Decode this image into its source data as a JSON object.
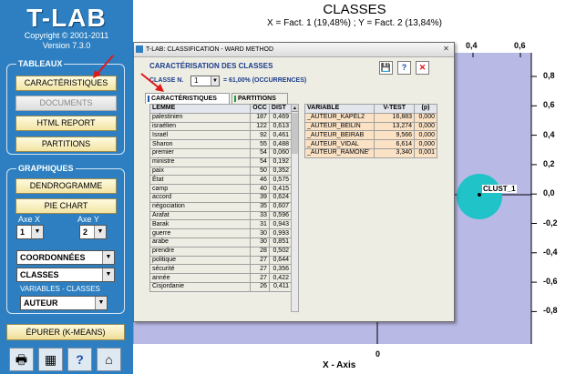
{
  "app": {
    "logo": "T-LAB",
    "copyright": "Copyright © 2001-2011",
    "version": "Version 7.3.0"
  },
  "sidebar": {
    "tableaux_title": "TABLEAUX",
    "btn_caracteristiques": "CARACTÉRISTIQUES",
    "btn_documents": "DOCUMENTS",
    "btn_html_report": "HTML REPORT",
    "btn_partitions": "PARTITIONS",
    "graphiques_title": "GRAPHIQUES",
    "btn_dendrogramme": "DENDROGRAMME",
    "btn_pie_chart": "PIE CHART",
    "axe_x_label": "Axe X",
    "axe_y_label": "Axe Y",
    "axe_x_value": "1",
    "axe_y_value": "2",
    "coordonnees": "COORDONNÉES",
    "classes": "CLASSES",
    "variables_title": "VARIABLES - CLASSES",
    "variables_value": "AUTEUR",
    "btn_epurer": "ÉPURER (K-MEANS)",
    "bottom_icons": [
      "print-icon",
      "table-chart-icon",
      "help-icon",
      "home-icon"
    ]
  },
  "chart": {
    "title": "CLASSES",
    "subtitle": "X = Fact. 1 (19,48%) ; Y = Fact. 2 (13,84%)",
    "x_ticks_top": [
      "0,4",
      "0,6"
    ],
    "y_ticks": [
      "0,8",
      "0,6",
      "0,4",
      "0,2",
      "0,0",
      "-0,2",
      "-0,4",
      "-0,6",
      "-0,8"
    ],
    "x_axis_zero": "0",
    "xlabel": "X - Axis",
    "cluster_label": "CLUST_1",
    "cluster_color": "#1fc3c8",
    "plot_color": "#b9b9e6"
  },
  "dialog": {
    "title": "T-LAB: CLASSIFICATION - WARD METHOD",
    "close_label": "✕",
    "header": "CARACTÉRISATION DES CLASSES",
    "classe_label": "CLASSE N.",
    "classe_value": "1",
    "pct_text": "= 61,00% (OCCURRENCES)",
    "tabs": [
      "CARACTÉRISTIQUES",
      "PARTITIONS"
    ],
    "lemma_columns": [
      "LEMME",
      "OCC",
      "DIST"
    ],
    "lemmas": [
      [
        "palestinien",
        "187",
        "0,469"
      ],
      [
        "israélien",
        "122",
        "0,613"
      ],
      [
        "Israël",
        "92",
        "0,461"
      ],
      [
        "Sharon",
        "55",
        "0,488"
      ],
      [
        "premier",
        "54",
        "0,060"
      ],
      [
        "ministre",
        "54",
        "0,192"
      ],
      [
        "paix",
        "50",
        "0,352"
      ],
      [
        "État",
        "46",
        "0,575"
      ],
      [
        "camp",
        "40",
        "0,415"
      ],
      [
        "accord",
        "39",
        "0,624"
      ],
      [
        "négociation",
        "35",
        "0,607"
      ],
      [
        "Arafat",
        "33",
        "0,596"
      ],
      [
        "Barak",
        "31",
        "0,943"
      ],
      [
        "guerre",
        "30",
        "0,993"
      ],
      [
        "arabe",
        "30",
        "0,851"
      ],
      [
        "prendre",
        "28",
        "0,502"
      ],
      [
        "politique",
        "27",
        "0,644"
      ],
      [
        "sécurité",
        "27",
        "0,356"
      ],
      [
        "année",
        "27",
        "0,422"
      ],
      [
        "Cisjordanie",
        "26",
        "0,411"
      ]
    ],
    "variable_columns": [
      "VARIABLE",
      "V-TEST",
      "(p)"
    ],
    "variables": [
      [
        "_AUTEUR_KAPEL2",
        "16,883",
        "0,000"
      ],
      [
        "_AUTEUR_BEILIN",
        "13,274",
        "0,000"
      ],
      [
        "_AUTEUR_BEIRAB",
        "9,566",
        "0,000"
      ],
      [
        "_AUTEUR_VIDAL",
        "6,614",
        "0,000"
      ],
      [
        "_AUTEUR_RAMONE'",
        "3,340",
        "0,001"
      ]
    ],
    "toolbar_icons": [
      "save-icon",
      "help-icon",
      "close-red-icon"
    ]
  }
}
